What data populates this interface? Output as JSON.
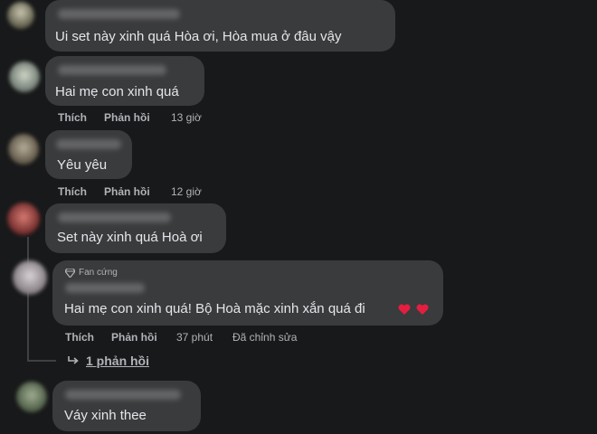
{
  "comments": [
    {
      "text": "Ui set này xinh quá Hòa ơi, Hòa mua ở đâu vậy"
    },
    {
      "text": "Hai mẹ con xinh quá",
      "like": "Thích",
      "reply": "Phản hồi",
      "time": "13 giờ"
    },
    {
      "text": "Yêu yêu",
      "like": "Thích",
      "reply": "Phản hồi",
      "time": "12 giờ"
    },
    {
      "text": "Set này xinh quá Hoà ơi"
    },
    {
      "badge": "Fan cứng",
      "text": "Hai mẹ con xinh quá! Bộ Hoà mặc xinh xắn quá đi",
      "like": "Thích",
      "reply": "Phản hồi",
      "time": "37 phút",
      "edited": "Đã chỉnh sửa",
      "view_replies": "1 phản hồi"
    },
    {
      "text": "Váy xinh thee"
    }
  ],
  "colors": {
    "background": "#18191a",
    "bubble": "#3a3b3c",
    "text": "#e4e6eb",
    "secondary_text": "#b0b3b8",
    "heart": "#e41e3f"
  },
  "icons": {
    "badge": "diamond-icon",
    "reply_arrow": "reply-arrow-icon",
    "reaction": "heart-icon"
  }
}
